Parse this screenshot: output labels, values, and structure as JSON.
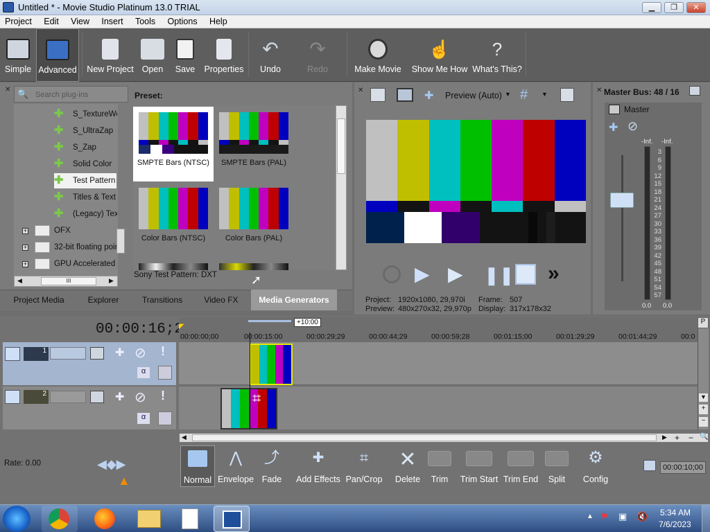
{
  "window": {
    "title": "Untitled * - Movie Studio Platinum 13.0 TRIAL",
    "min": "▁",
    "max": "❐",
    "close": "✕"
  },
  "menu": [
    "Project",
    "Edit",
    "View",
    "Insert",
    "Tools",
    "Options",
    "Help"
  ],
  "toolbar": {
    "simple": "Simple",
    "advanced": "Advanced",
    "new_project": "New Project",
    "open": "Open",
    "save": "Save",
    "properties": "Properties",
    "undo": "Undo",
    "redo": "Redo",
    "make_movie": "Make Movie",
    "show_me_how": "Show Me How",
    "whats_this": "What's This?"
  },
  "plugins": {
    "search_placeholder": "Search plug-ins",
    "items": [
      "S_TextureWe",
      "S_UltraZap",
      "S_Zap",
      "Solid Color",
      "Test Pattern",
      "Titles & Text",
      "(Legacy) Tex"
    ],
    "folders": [
      "OFX",
      "32-bit floating poin",
      "GPU Accelerated"
    ],
    "scroll_mark": "III"
  },
  "preset": {
    "label": "Preset:",
    "items": [
      "SMPTE Bars (NTSC)",
      "SMPTE Bars (PAL)",
      "Color Bars (NTSC)",
      "Color Bars (PAL)"
    ],
    "status": "Sony Test Pattern: DXT"
  },
  "tabs": [
    "Project Media",
    "Explorer",
    "Transitions",
    "Video FX",
    "Media Generators"
  ],
  "preview": {
    "mode": "Preview (Auto)",
    "project_label": "Project:",
    "project_value": "1920x1080, 29,970i",
    "preview_label": "Preview:",
    "preview_value": "480x270x32, 29,970p",
    "frame_label": "Frame:",
    "frame_value": "507",
    "display_label": "Display:",
    "display_value": "317x178x32"
  },
  "master": {
    "title": "Master Bus: 48 / 16",
    "name": "Master",
    "peak_left": "-Inf.",
    "peak_right": "-Inf.",
    "scale": [
      "3",
      "6",
      "9",
      "12",
      "15",
      "18",
      "21",
      "24",
      "27",
      "30",
      "33",
      "36",
      "39",
      "42",
      "45",
      "48",
      "51",
      "54",
      "57"
    ],
    "bottom_left": "0.0",
    "bottom_right": "0.0"
  },
  "timeline": {
    "time": "00:00:16;27",
    "marker": "+10:00",
    "ticks": [
      "00:00:00;00",
      "00:00:15:00",
      "00:00:29;29",
      "00:00:44;29",
      "00:00:59;28",
      "00:01:15;00",
      "00:01:29;29",
      "00:01:44;29",
      "00:0"
    ],
    "track1": "1",
    "track2": "2",
    "rate": "Rate: 0.00",
    "end_time": "00:00:10;00"
  },
  "edit_tools": {
    "normal": "Normal",
    "envelope": "Envelope",
    "fade": "Fade",
    "add_effects": "Add Effects",
    "pan_crop": "Pan/Crop",
    "delete": "Delete",
    "trim": "Trim",
    "trim_start": "Trim Start",
    "trim_end": "Trim End",
    "split": "Split",
    "config": "Config"
  },
  "taskbar": {
    "time": "5:34 AM",
    "date": "7/6/2023"
  },
  "colors": {
    "bars_top": [
      "#c0c0c0",
      "#bfbf00",
      "#00bfbf",
      "#00bf00",
      "#bf00bf",
      "#bf0000",
      "#0000bf"
    ]
  }
}
